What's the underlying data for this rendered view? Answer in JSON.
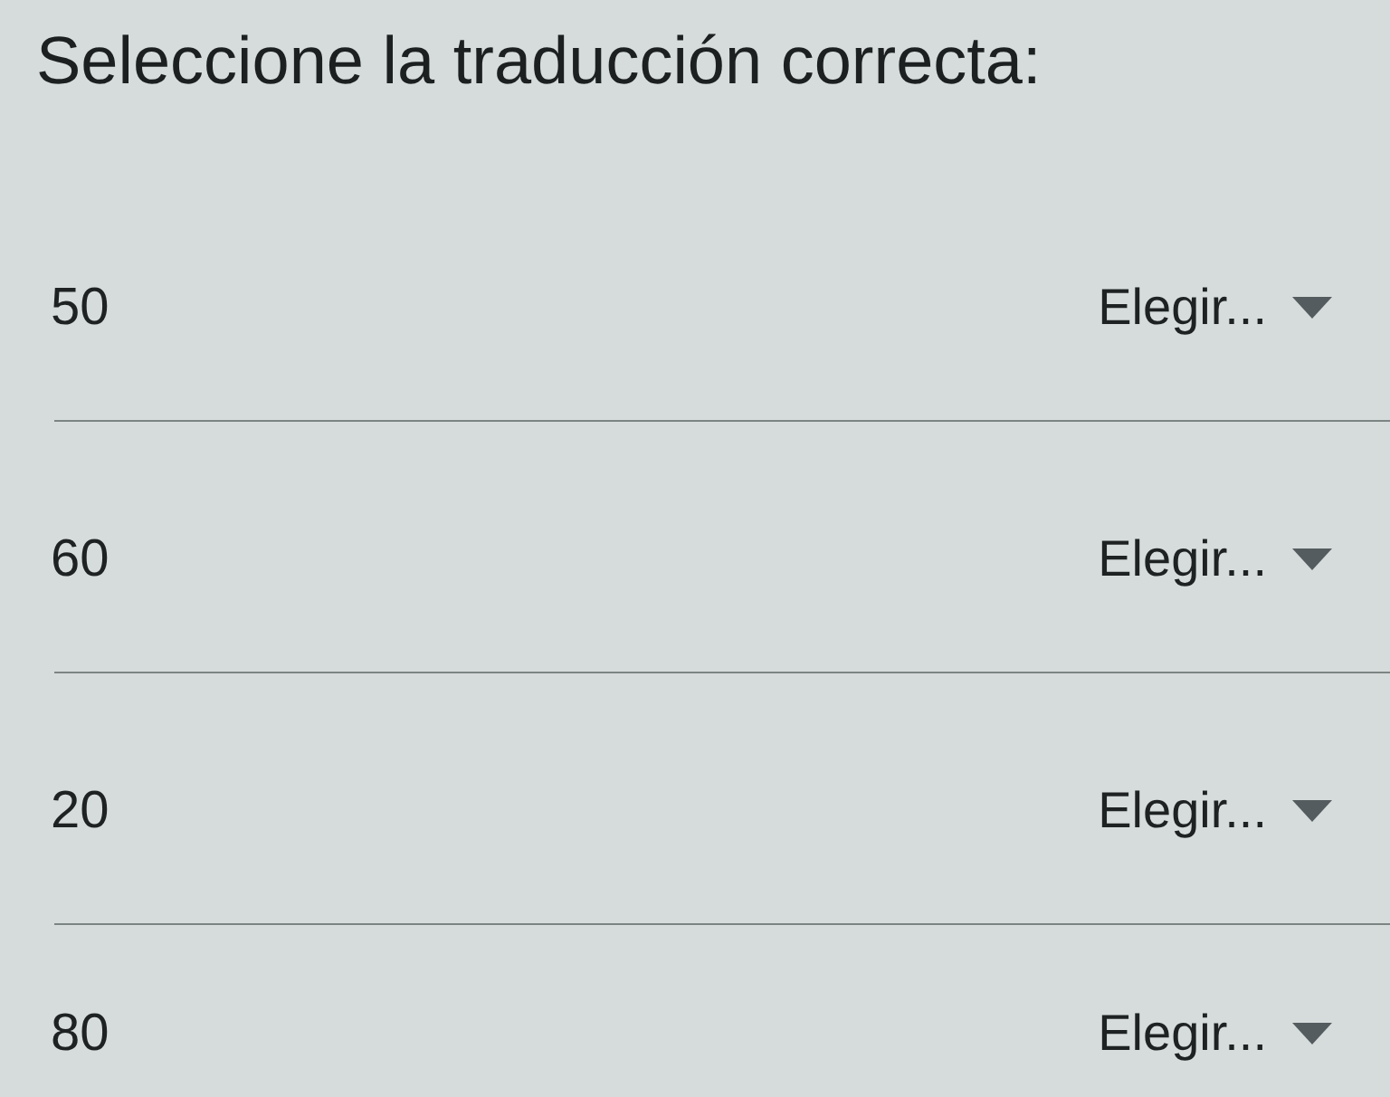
{
  "title": "Seleccione la traducción correcta:",
  "rows": [
    {
      "label": "50",
      "dropdown": {
        "placeholder": "Elegir..."
      }
    },
    {
      "label": "60",
      "dropdown": {
        "placeholder": "Elegir..."
      }
    },
    {
      "label": "20",
      "dropdown": {
        "placeholder": "Elegir..."
      }
    },
    {
      "label": "80",
      "dropdown": {
        "placeholder": "Elegir..."
      }
    }
  ]
}
